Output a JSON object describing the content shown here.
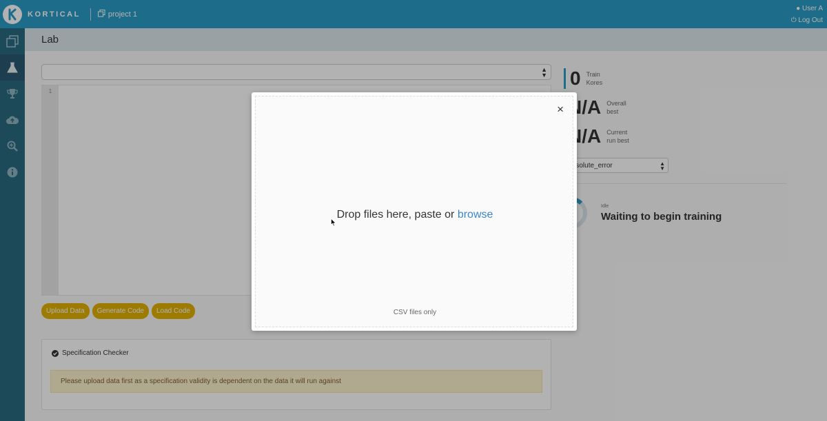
{
  "topbar": {
    "brand": "KORTICAL",
    "project_name": "project 1",
    "user_name": "User A",
    "logout_label": "Log Out"
  },
  "sidebar": {
    "items": [
      {
        "icon": "copy-icon"
      },
      {
        "icon": "flask-icon"
      },
      {
        "icon": "trophy-icon"
      },
      {
        "icon": "cloud-upload-icon"
      },
      {
        "icon": "zoom-icon"
      },
      {
        "icon": "info-icon"
      }
    ]
  },
  "main": {
    "title": "Lab",
    "editor": {
      "line_number": "1"
    },
    "buttons": {
      "upload_data": "Upload Data",
      "generate_code": "Generate Code",
      "load_code": "Load Code"
    },
    "spec_checker": {
      "title": "Specification Checker",
      "message": "Please upload data first as a specification validity is dependent on the data it will run against"
    }
  },
  "right_panel": {
    "train_kores": {
      "value": "0",
      "label_line1": "Train",
      "label_line2": "Kores"
    },
    "overall_best": {
      "value": "N/A",
      "label_line1": "Overall",
      "label_line2": "best"
    },
    "current_run_best": {
      "value": "N/A",
      "label_line1": "Current",
      "label_line2": "run best"
    },
    "metric_select": "ean_absolute_error",
    "status_small": "Idle",
    "status": "Waiting to begin training"
  },
  "modal": {
    "drop_text": "Drop files here, paste or",
    "browse_label": "browse",
    "hint": "CSV files only",
    "close_label": "×"
  },
  "colors": {
    "accent": "#2a9cc6",
    "sidebar": "#2a6a80",
    "button_yellow": "#e0b000",
    "link_blue": "#3a86c9"
  }
}
